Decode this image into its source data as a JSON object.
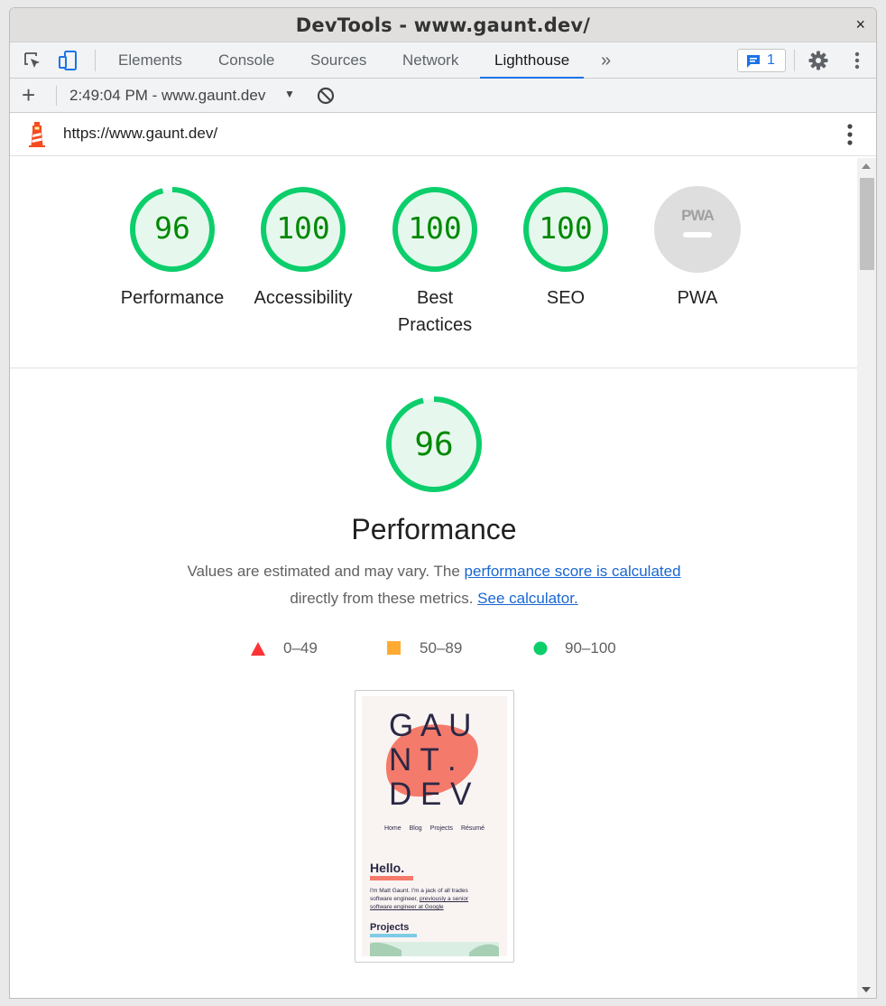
{
  "window": {
    "title": "DevTools - www.gaunt.dev/",
    "close_label": "×"
  },
  "tabs": [
    {
      "label": "Elements"
    },
    {
      "label": "Console"
    },
    {
      "label": "Sources"
    },
    {
      "label": "Network"
    },
    {
      "label": "Lighthouse"
    }
  ],
  "more_tabs": "»",
  "issues_count": "1",
  "report": {
    "label": "2:49:04 PM - www.gaunt.dev"
  },
  "url": "https://www.gaunt.dev/",
  "categories": [
    {
      "score": "96",
      "label": "Performance",
      "fraction": 0.96
    },
    {
      "score": "100",
      "label": "Accessibility",
      "fraction": 1.0
    },
    {
      "score": "100",
      "label_line1": "Best",
      "label_line2": "Practices",
      "fraction": 1.0
    },
    {
      "score": "100",
      "label": "SEO",
      "fraction": 1.0
    },
    {
      "badge": "PWA",
      "label": "PWA"
    }
  ],
  "performance": {
    "score": "96",
    "fraction": 0.96,
    "title": "Performance",
    "desc_part1": "Values are estimated and may vary. The ",
    "desc_link1": "performance score is calculated",
    "desc_part2": "directly from these metrics.",
    "desc_link2": "See calculator."
  },
  "legend": [
    {
      "label": "0–49",
      "color": "#ff3333"
    },
    {
      "label": "50–89",
      "color": "#ffaa33"
    },
    {
      "label": "90–100",
      "color": "#0cce6b"
    }
  ],
  "colors": {
    "pass": "#0cce6b",
    "pass_text": "#008800",
    "pass_fill": "#e6f8ee",
    "accent": "#1a73e8",
    "link": "#1967d2",
    "pwa_gray": "#dedede"
  },
  "screenshot": {
    "logo_line1": "G A U",
    "logo_line2": "N T .",
    "logo_line3": "D E V",
    "nav_items": [
      "Home",
      "Blog",
      "Projects",
      "Résumé"
    ],
    "hello": "Hello.",
    "intro_1": "I'm Matt Gaunt. I'm a jack of all trades",
    "intro_2a": "software engineer, ",
    "intro_2b": "previously a senior",
    "intro_3": "software engineer at Google",
    "projects": "Projects",
    "blob_color": "#f47a6b",
    "hello_underline": "#f47a6b",
    "projects_underline": "#7ecbe6"
  }
}
